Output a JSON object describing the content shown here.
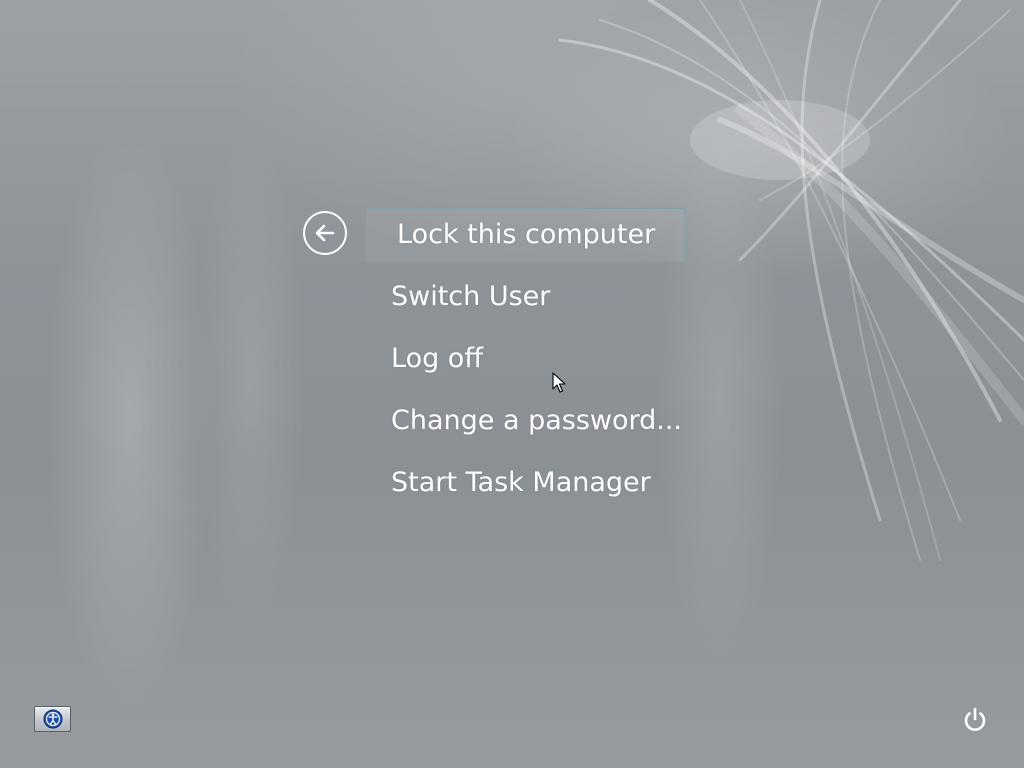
{
  "menu": {
    "items": [
      {
        "label": "Lock this computer",
        "focused": true
      },
      {
        "label": "Switch User"
      },
      {
        "label": "Log off"
      },
      {
        "label": "Change a password..."
      },
      {
        "label": "Start Task Manager"
      }
    ]
  },
  "icons": {
    "back": "back-arrow-icon",
    "ease_of_access": "ease-of-access-icon",
    "power": "power-icon",
    "cursor": "mouse-pointer-icon"
  },
  "colors": {
    "text": "#ffffff",
    "focus_border": "#6ea0aa",
    "background": "#8e9398"
  }
}
